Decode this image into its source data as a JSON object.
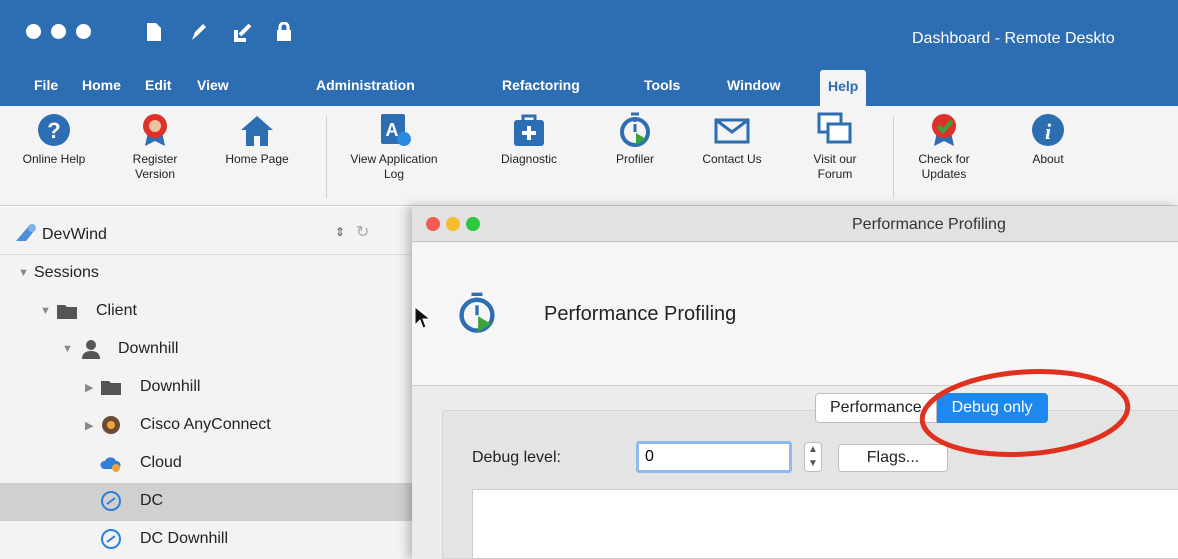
{
  "window": {
    "title": "Dashboard - Remote Deskto"
  },
  "menu": [
    "File",
    "Home",
    "Edit",
    "View",
    "Administration",
    "Refactoring",
    "Tools",
    "Window",
    "Help"
  ],
  "menu_active": "Help",
  "ribbon": [
    {
      "label": "Online Help",
      "icon": "question-icon"
    },
    {
      "label": "Register\nVersion",
      "icon": "award-ribbon-icon"
    },
    {
      "label": "Home Page",
      "icon": "home-icon"
    },
    {
      "label": "View Application\nLog",
      "icon": "app-log-icon"
    },
    {
      "label": "Diagnostic",
      "icon": "medical-kit-icon"
    },
    {
      "label": "Profiler",
      "icon": "stopwatch-icon"
    },
    {
      "label": "Contact Us",
      "icon": "envelope-icon"
    },
    {
      "label": "Visit our\nForum",
      "icon": "chat-bubbles-icon"
    },
    {
      "label": "Check for\nUpdates",
      "icon": "award-check-icon"
    },
    {
      "label": "About",
      "icon": "info-icon"
    }
  ],
  "sidebar": {
    "datasource": "DevWind",
    "tree": [
      {
        "label": "Sessions",
        "kind": "section"
      },
      {
        "label": "Client",
        "kind": "folder"
      },
      {
        "label": "Downhill",
        "kind": "user"
      },
      {
        "label": "Downhill",
        "kind": "folder"
      },
      {
        "label": "Cisco AnyConnect",
        "kind": "vpn"
      },
      {
        "label": "Cloud",
        "kind": "cloud"
      },
      {
        "label": "DC",
        "kind": "dc",
        "selected": true
      },
      {
        "label": "DC Downhill",
        "kind": "dc"
      }
    ]
  },
  "dialog": {
    "title": "Performance Profiling",
    "header": "Performance Profiling",
    "mode_performance": "Performance",
    "mode_debug": "Debug only",
    "debug_level_label": "Debug level:",
    "debug_level_value": "0",
    "flags_label": "Flags..."
  },
  "colors": {
    "brand": "#2d6db1",
    "selected": "#1e88ee",
    "annotation": "#e0301e"
  }
}
